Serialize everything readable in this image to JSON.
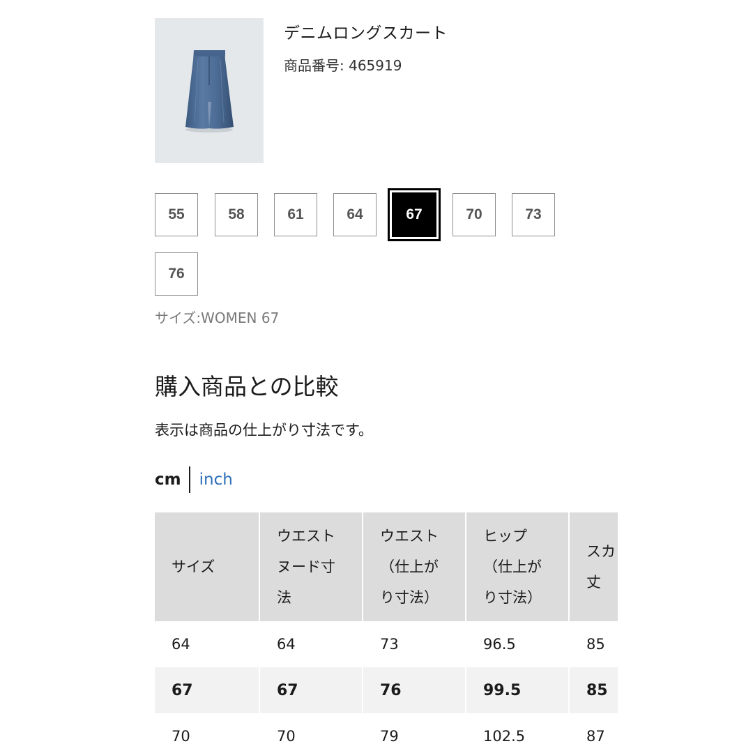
{
  "product": {
    "name": "デニムロングスカート",
    "code": "商品番号: 465919",
    "image_icon": "denim-skirt-image"
  },
  "sizes": {
    "options": [
      "55",
      "58",
      "61",
      "64",
      "67",
      "70",
      "73",
      "76"
    ],
    "selected": "67",
    "caption": "サイズ:WOMEN 67"
  },
  "comparison": {
    "title": "購入商品との比較",
    "note": "表示は商品の仕上がり寸法です。",
    "unit_cm": "cm",
    "unit_inch": "inch"
  },
  "table": {
    "headers": [
      [
        "サイズ"
      ],
      [
        "ウエスト",
        "ヌード寸",
        "法"
      ],
      [
        "ウエスト",
        "（仕上が",
        "り寸法）"
      ],
      [
        "ヒップ",
        "（仕上が",
        "り寸法）"
      ],
      [
        "スカ",
        "丈"
      ]
    ],
    "rows": [
      {
        "size": "64",
        "waist_nude": "64",
        "waist": "73",
        "hip": "96.5",
        "length": "85"
      },
      {
        "size": "67",
        "waist_nude": "67",
        "waist": "76",
        "hip": "99.5",
        "length": "85"
      },
      {
        "size": "70",
        "waist_nude": "70",
        "waist": "79",
        "hip": "102.5",
        "length": "87"
      }
    ]
  },
  "colors": {
    "selected_bg": "#000000",
    "link_blue": "#2e6fb8",
    "header_gray": "#dcdcdc",
    "highlight_row": "#f2f2f2"
  }
}
